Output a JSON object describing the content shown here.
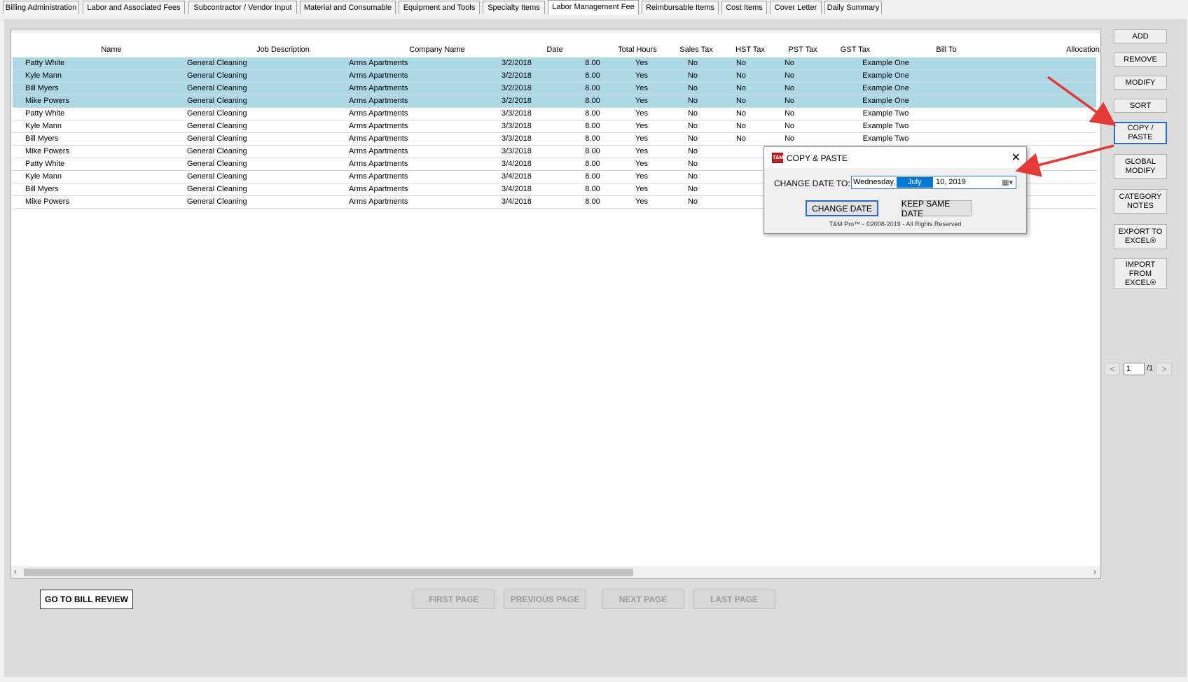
{
  "tabs": [
    {
      "label": "Billing Administration",
      "active": false
    },
    {
      "label": "Labor and Associated Fees",
      "active": false
    },
    {
      "label": "Subcontractor / Vendor Input",
      "active": false
    },
    {
      "label": "Material and Consumable",
      "active": false
    },
    {
      "label": "Equipment and Tools",
      "active": false
    },
    {
      "label": "Specialty Items",
      "active": false
    },
    {
      "label": "Labor Management Fee",
      "active": true
    },
    {
      "label": "Reimbursable Items",
      "active": false
    },
    {
      "label": "Cost Items",
      "active": false
    },
    {
      "label": "Cover Letter",
      "active": false
    },
    {
      "label": "Daily Summary",
      "active": false
    }
  ],
  "grid": {
    "columns": [
      "Name",
      "Job Description",
      "Company Name",
      "Date",
      "Total Hours",
      "Sales Tax",
      "HST Tax",
      "PST Tax",
      "GST Tax",
      "Bill To",
      "Allocation"
    ],
    "rows": [
      {
        "selected": true,
        "cells": [
          "Patty White",
          "General Cleaning",
          "Arms Apartments",
          "3/2/2018",
          "8.00",
          "Yes",
          "No",
          "No",
          "No",
          "Example One",
          ""
        ]
      },
      {
        "selected": true,
        "cells": [
          "Kyle Mann",
          "General Cleaning",
          "Arms Apartments",
          "3/2/2018",
          "8.00",
          "Yes",
          "No",
          "No",
          "No",
          "Example One",
          ""
        ]
      },
      {
        "selected": true,
        "cells": [
          "Bill Myers",
          "General Cleaning",
          "Arms Apartments",
          "3/2/2018",
          "8.00",
          "Yes",
          "No",
          "No",
          "No",
          "Example One",
          ""
        ]
      },
      {
        "selected": true,
        "cells": [
          "Mike Powers",
          "General Cleaning",
          "Arms Apartments",
          "3/2/2018",
          "8.00",
          "Yes",
          "No",
          "No",
          "No",
          "Example One",
          ""
        ]
      },
      {
        "selected": false,
        "cells": [
          "Patty White",
          "General Cleaning",
          "Arms Apartments",
          "3/3/2018",
          "8.00",
          "Yes",
          "No",
          "No",
          "No",
          "Example Two",
          ""
        ]
      },
      {
        "selected": false,
        "cells": [
          "Kyle Mann",
          "General Cleaning",
          "Arms Apartments",
          "3/3/2018",
          "8.00",
          "Yes",
          "No",
          "No",
          "No",
          "Example Two",
          ""
        ]
      },
      {
        "selected": false,
        "cells": [
          "Bill Myers",
          "General Cleaning",
          "Arms Apartments",
          "3/3/2018",
          "8.00",
          "Yes",
          "No",
          "No",
          "No",
          "Example Two",
          ""
        ]
      },
      {
        "selected": false,
        "cells": [
          "Mike Powers",
          "General Cleaning",
          "Arms Apartments",
          "3/3/2018",
          "8.00",
          "Yes",
          "No",
          "",
          "",
          "",
          ""
        ]
      },
      {
        "selected": false,
        "cells": [
          "Patty White",
          "General Cleaning",
          "Arms Apartments",
          "3/4/2018",
          "8.00",
          "Yes",
          "No",
          "",
          "",
          "",
          ""
        ]
      },
      {
        "selected": false,
        "cells": [
          "Kyle Mann",
          "General Cleaning",
          "Arms Apartments",
          "3/4/2018",
          "8.00",
          "Yes",
          "No",
          "",
          "",
          "",
          ""
        ]
      },
      {
        "selected": false,
        "cells": [
          "Bill Myers",
          "General Cleaning",
          "Arms Apartments",
          "3/4/2018",
          "8.00",
          "Yes",
          "No",
          "",
          "",
          "",
          ""
        ]
      },
      {
        "selected": false,
        "cells": [
          "Mike Powers",
          "General Cleaning",
          "Arms Apartments",
          "3/4/2018",
          "8.00",
          "Yes",
          "No",
          "",
          "",
          "",
          ""
        ]
      }
    ]
  },
  "side_buttons": [
    "ADD",
    "REMOVE",
    "MODIFY",
    "SORT",
    "COPY /\nPASTE",
    "GLOBAL\nMODIFY",
    "CATEGORY\nNOTES",
    "EXPORT TO\nEXCEL®",
    "IMPORT\nFROM\nEXCEL®"
  ],
  "pager": {
    "prev": "<",
    "page": "1",
    "total": "/1",
    "next": ">"
  },
  "bottom": {
    "bill_review": "GO TO BILL REVIEW",
    "first": "FIRST PAGE",
    "previous": "PREVIOUS PAGE",
    "next": "NEXT PAGE",
    "last": "LAST PAGE"
  },
  "dialog": {
    "icon": "T&M",
    "title": "COPY & PASTE",
    "label": "CHANGE DATE TO:",
    "date_weekday": "Wednesday,",
    "date_month": "July",
    "date_rest": "10, 2019",
    "change_btn": "CHANGE DATE",
    "keep_btn": "KEEP SAME DATE",
    "copyright": "T&M Pro™ - ©2008-2019 - All Rights Reserved"
  },
  "colors": {
    "selection": "#add8e6",
    "annotation_arrow": "#e53935",
    "focus_border": "#2b6bbf"
  }
}
